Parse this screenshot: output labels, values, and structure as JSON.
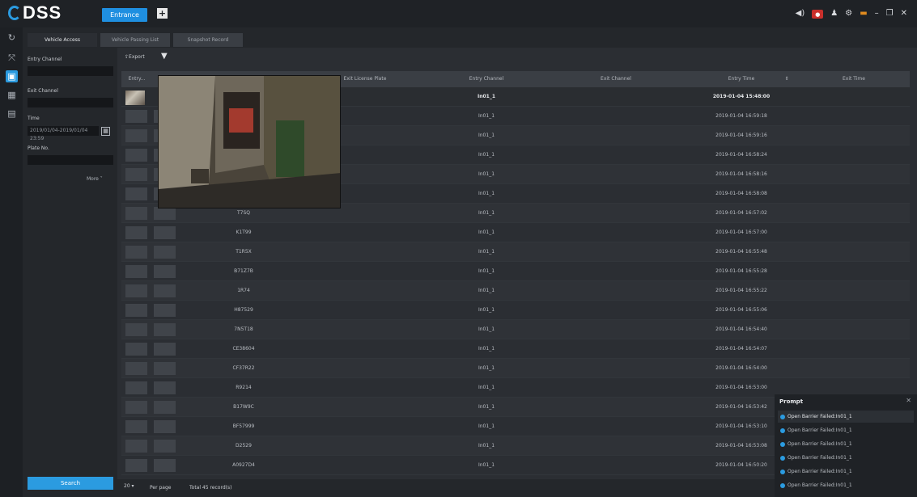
{
  "app": {
    "logo": "DSS",
    "entrance_tab": "Entrance",
    "add_tab": "+"
  },
  "topbar_icons": [
    "speaker-icon",
    "alarm-icon",
    "user-icon",
    "gear-icon",
    "warning-icon",
    "minimize-icon",
    "restore-icon",
    "close-icon"
  ],
  "subtabs": [
    "Vehicle Access",
    "Vehicle Passing List",
    "Snapshot Record"
  ],
  "filters": {
    "entry_channel_label": "Entry Channel",
    "entry_channel_value": "",
    "exit_channel_label": "Exit Channel",
    "exit_channel_value": "",
    "time_label": "Time",
    "time_value": "2019/01/04-2019/01/04 23:59",
    "plate_label": "Plate No.",
    "plate_value": "",
    "more_label": "More ˅",
    "search_label": "Search"
  },
  "toolbar": {
    "export_label": "Export"
  },
  "table": {
    "headers": [
      "Entry...",
      "",
      "Exit License Plate",
      "Entry Channel",
      "Exit Channel",
      "Entry Time",
      "",
      "Exit Time"
    ],
    "rows": [
      {
        "plate": "",
        "entry_channel": "In01_1",
        "exit_channel": "",
        "entry_time": "2019-01-04 15:48:00",
        "bold": true
      },
      {
        "plate": "",
        "entry_channel": "In01_1",
        "exit_channel": "",
        "entry_time": "2019-01-04 16:59:18",
        "bold": false
      },
      {
        "plate": "",
        "entry_channel": "In01_1",
        "exit_channel": "",
        "entry_time": "2019-01-04 16:59:16",
        "bold": false
      },
      {
        "plate": "",
        "entry_channel": "In01_1",
        "exit_channel": "",
        "entry_time": "2019-01-04 16:58:24",
        "bold": false
      },
      {
        "plate": "",
        "entry_channel": "In01_1",
        "exit_channel": "",
        "entry_time": "2019-01-04 16:58:16",
        "bold": false
      },
      {
        "plate": "",
        "entry_channel": "In01_1",
        "exit_channel": "",
        "entry_time": "2019-01-04 16:58:08",
        "bold": false
      },
      {
        "plate": "T7SQ",
        "entry_channel": "In01_1",
        "exit_channel": "",
        "entry_time": "2019-01-04 16:57:02",
        "bold": false
      },
      {
        "plate": "K1T99",
        "entry_channel": "In01_1",
        "exit_channel": "",
        "entry_time": "2019-01-04 16:57:00",
        "bold": false
      },
      {
        "plate": "T1R5X",
        "entry_channel": "In01_1",
        "exit_channel": "",
        "entry_time": "2019-01-04 16:55:48",
        "bold": false
      },
      {
        "plate": "B71Z7B",
        "entry_channel": "In01_1",
        "exit_channel": "",
        "entry_time": "2019-01-04 16:55:28",
        "bold": false
      },
      {
        "plate": "1R74",
        "entry_channel": "In01_1",
        "exit_channel": "",
        "entry_time": "2019-01-04 16:55:22",
        "bold": false
      },
      {
        "plate": "H87529",
        "entry_channel": "In01_1",
        "exit_channel": "",
        "entry_time": "2019-01-04 16:55:06",
        "bold": false
      },
      {
        "plate": "7N5T18",
        "entry_channel": "In01_1",
        "exit_channel": "",
        "entry_time": "2019-01-04 16:54:40",
        "bold": false
      },
      {
        "plate": "CE38604",
        "entry_channel": "In01_1",
        "exit_channel": "",
        "entry_time": "2019-01-04 16:54:07",
        "bold": false
      },
      {
        "plate": "CF37R22",
        "entry_channel": "In01_1",
        "exit_channel": "",
        "entry_time": "2019-01-04 16:54:00",
        "bold": false
      },
      {
        "plate": "R9214",
        "entry_channel": "In01_1",
        "exit_channel": "",
        "entry_time": "2019-01-04 16:53:00",
        "bold": false
      },
      {
        "plate": "B17W9C",
        "entry_channel": "In01_1",
        "exit_channel": "",
        "entry_time": "2019-01-04 16:53:42",
        "bold": false
      },
      {
        "plate": "BF57999",
        "entry_channel": "In01_1",
        "exit_channel": "",
        "entry_time": "2019-01-04 16:53:10",
        "bold": false
      },
      {
        "plate": "D2529",
        "entry_channel": "In01_1",
        "exit_channel": "",
        "entry_time": "2019-01-04 16:53:08",
        "bold": false
      },
      {
        "plate": "A0927D4",
        "entry_channel": "In01_1",
        "exit_channel": "",
        "entry_time": "2019-01-04 16:50:20",
        "bold": false
      }
    ]
  },
  "footer": {
    "page_size": "20 ▾",
    "per_page_label": "Per page",
    "total_label": "Total 45 record(s)"
  },
  "prompt": {
    "title": "Prompt",
    "close": "✕",
    "items": [
      "Open Barrier Failed:In01_1",
      "Open Barrier Failed:In01_1",
      "Open Barrier Failed:In01_1",
      "Open Barrier Failed:In01_1",
      "Open Barrier Failed:In01_1",
      "Open Barrier Failed:In01_1"
    ]
  },
  "colors": {
    "accent": "#2b9be0",
    "alarm": "#c9302c",
    "warning": "#e08b1f",
    "background": "#2b2e33"
  }
}
